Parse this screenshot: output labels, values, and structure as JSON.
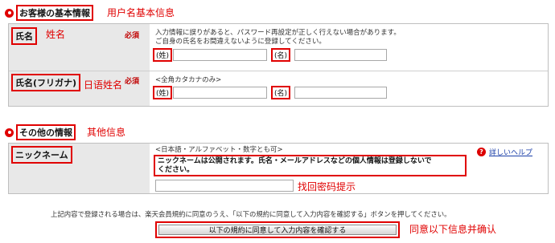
{
  "basic_section": {
    "title": "お客様の基本情報",
    "annotation": "用户名基本信息"
  },
  "name_row": {
    "label": "氏名",
    "annotation": "姓名",
    "required": "必須",
    "help_line1": "入力情報に誤りがあると、パスワード再設定が正しく行えない場合があります。",
    "help_line2": "ご自身の氏名をお間違えないように登録してください。",
    "last_tag": "(姓)",
    "first_tag": "(名)"
  },
  "kana_row": {
    "label": "氏名(フリガナ)",
    "annotation": "日语姓名",
    "required": "必須",
    "hint": "<全角カタカナのみ>",
    "last_tag": "(姓)",
    "first_tag": "(名)"
  },
  "other_section": {
    "title": "その他の情報",
    "annotation": "其他信息"
  },
  "nickname_row": {
    "label": "ニックネーム",
    "hint": "<日本語・アルファベット・数字とも可>",
    "warning_line1": "ニックネームは公開されます。氏名・メールアドレスなどの個人情報は登録しないで",
    "warning_line2": "ください。",
    "help_link": "詳しいヘルプ",
    "help_icon_text": "?",
    "annotation": "找回密码提示"
  },
  "footer": {
    "notice": "上記内容で登録される場合は、楽天会員規約に同意のうえ、「以下の規約に同意して入力内容を確認する」ボタンを押してください。",
    "confirm_button": "以下の規約に同意して入力内容を確認する",
    "annotation": "同意以下信息并确认"
  }
}
